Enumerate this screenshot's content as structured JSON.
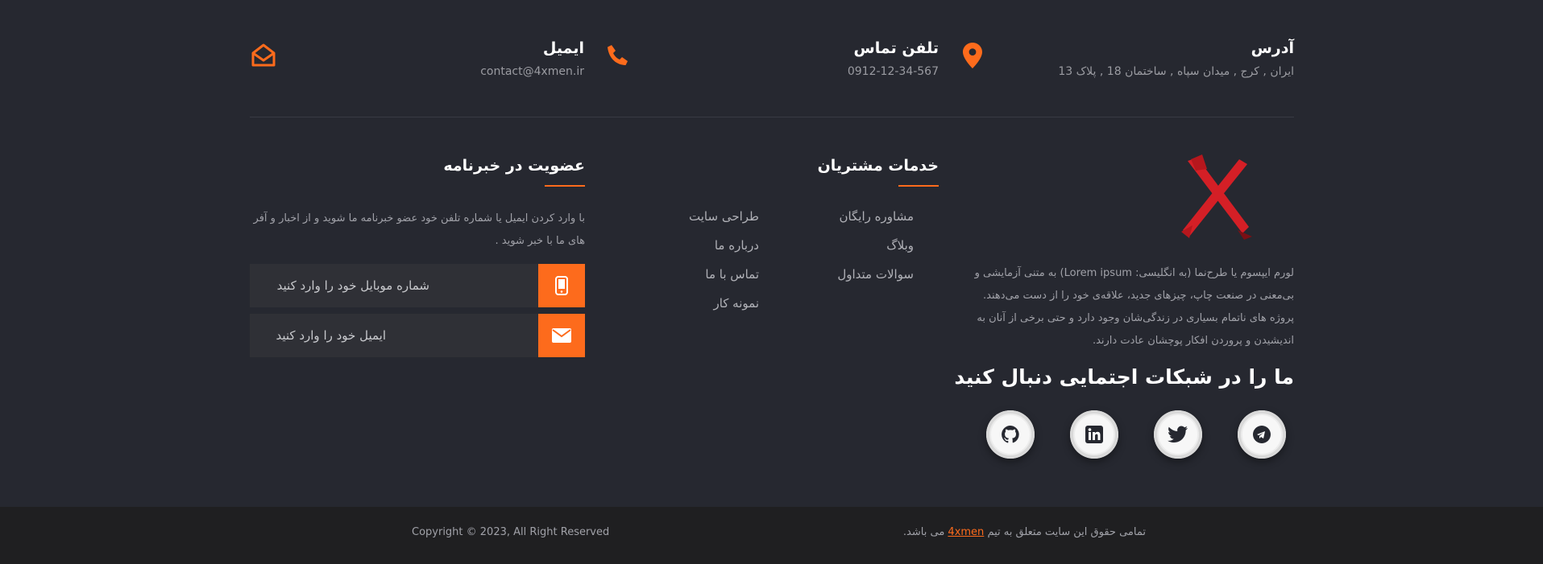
{
  "contact": {
    "address": {
      "title": "آدرس",
      "value": "ایران , کرج , میدان سپاه , ساختمان 18 , پلاک 13",
      "icon": "map-marker-icon"
    },
    "phone": {
      "title": "تلفن تماس",
      "value": "0912-12-34-567",
      "icon": "phone-icon"
    },
    "email": {
      "title": "ایمیل",
      "value": "contact@4xmen.ir",
      "icon": "envelope-open-icon"
    }
  },
  "about": {
    "logo": "4xmen-x-logo",
    "text": "لورم ایپسوم یا طرح‌نما (به انگلیسی: Lorem ipsum) به متنی آزمایشی و بی‌معنی در صنعت چاپ، چیزهای جدید، علاقه‌ی خود را از دست می‌دهند. پروژه های ناتمام بسیاری در زندگی‌شان وجود دارد و حتی برخی از آنان به اندیشیدن و پروردن افکار پوچشان عادت دارند.",
    "follow_title": "ما را در شبکات اجتمایی دنبال کنید",
    "socials": [
      "telegram-icon",
      "twitter-icon",
      "linkedin-icon",
      "github-icon"
    ]
  },
  "services": {
    "title": "خدمات مشتریان",
    "col1": [
      "مشاوره رایگان",
      "وبلاگ",
      "سوالات متداول"
    ],
    "col2": [
      "طراحی سایت",
      "درباره ما",
      "تماس با ما",
      "نمونه کار"
    ]
  },
  "newsletter": {
    "title": "عضویت در خبرنامه",
    "text": "با وارد کردن ایمیل یا شماره تلفن خود عضو خبرنامه ما شوید و از اخبار و آفر های ما با خبر شوید .",
    "mobile_placeholder": "شماره موبایل خود را وارد کنید",
    "email_placeholder": "ایمیل خود را وارد کنید"
  },
  "footer": {
    "rights_before": "تمامی حقوق این سایت متعلق به تیم",
    "brand": "4xmen",
    "rights_after": "می باشد.",
    "copyright": "Copyright © 2023, All Right Reserved"
  },
  "colors": {
    "accent": "#fd6b1c",
    "background": "#262830",
    "bottom_bar": "#1f1f21",
    "logo_red": "#d41f26"
  }
}
